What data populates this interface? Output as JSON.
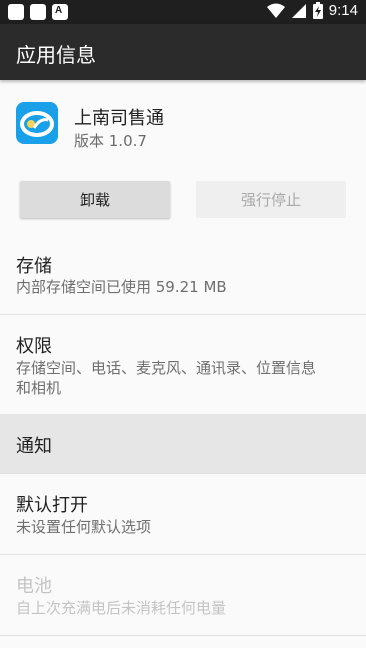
{
  "status_bar": {
    "time": "9:14",
    "notification_icons": [
      "square-icon",
      "square-icon",
      "a-notification-icon"
    ],
    "right_icons": [
      "wifi-icon",
      "cellular-icon",
      "battery-charging-icon"
    ]
  },
  "app_bar": {
    "title": "应用信息",
    "background": "#2b2b2b"
  },
  "app": {
    "name": "上南司售通",
    "version": "版本 1.0.7",
    "icon": "app-logo-icon",
    "icon_color": "#1aa0e8"
  },
  "actions": {
    "uninstall_label": "卸载",
    "force_stop_label": "强行停止"
  },
  "sections": {
    "storage": {
      "title": "存储",
      "subtitle": "内部存储空间已使用 59.21 MB"
    },
    "permissions": {
      "title": "权限",
      "subtitle_line1": "存储空间、电话、麦克风、通讯录、位置信息",
      "subtitle_line2": "和相机"
    },
    "notifications": {
      "title": "通知"
    },
    "open_by_default": {
      "title": "默认打开",
      "subtitle": "未设置任何默认选项"
    },
    "battery": {
      "title": "电池",
      "subtitle": "自上次充满电后未消耗任何电量"
    }
  }
}
